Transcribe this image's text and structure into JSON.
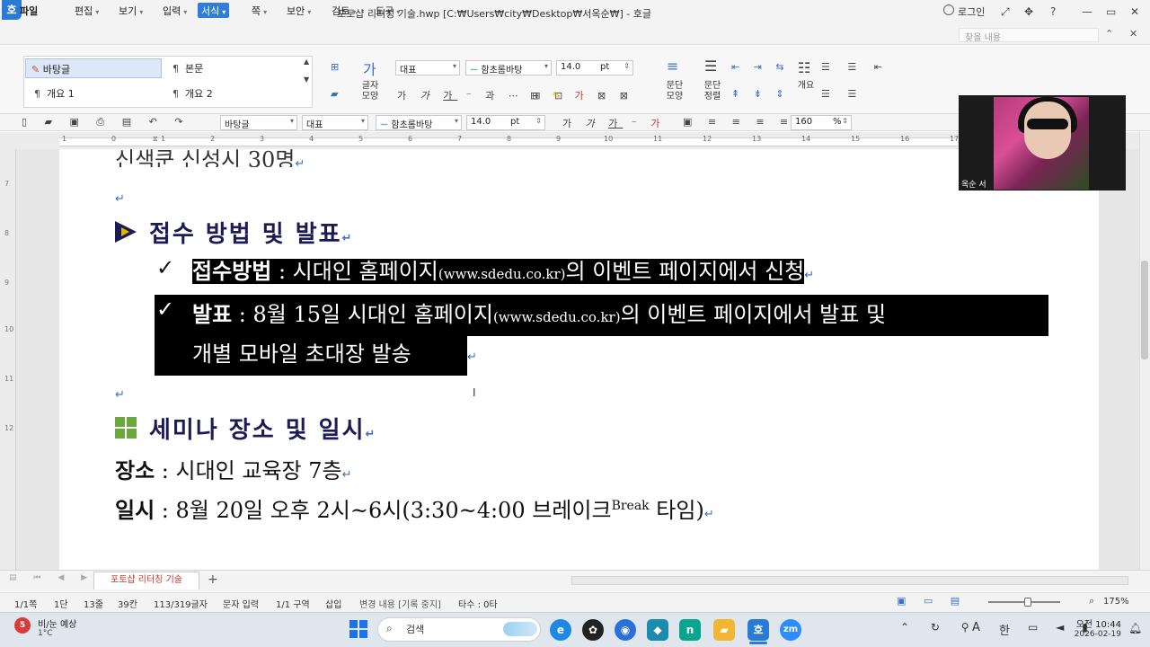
{
  "titlebar": {
    "logo": "호",
    "title": "포토샵 리터칭 기술.hwp [C:₩Users₩city₩Desktop₩서옥순₩] - 호글",
    "login": "로그인",
    "help": "?",
    "min": "—",
    "max": "▭",
    "close": "✕"
  },
  "menubar": {
    "file": "파일",
    "items": [
      "편집",
      "보기",
      "입력",
      "서식",
      "쪽",
      "보안",
      "검토",
      "도구"
    ],
    "find_placeholder": "찾을 내용"
  },
  "ribbon": {
    "styles": [
      "바탕글",
      "본문",
      "개요 1",
      "개요 2"
    ],
    "char_shape": "글자\n모양",
    "lang_combo": "대표",
    "font_combo": "함초롬바탕",
    "size_combo": "14.0",
    "size_unit": "pt",
    "para_shape": "문단\n모양",
    "para_sort": "문단\n정렬",
    "outline": "개요"
  },
  "toolbar2": {
    "style_combo": "바탕글",
    "lang_combo": "대표",
    "font_combo": "함초롬바탕",
    "size_combo": "14.0",
    "size_unit": "pt",
    "zoom_combo": "160",
    "zoom_unit": "%"
  },
  "ruler": {
    "h_ticks": [
      "1",
      "0",
      "1",
      "2",
      "3",
      "4",
      "5",
      "6",
      "7",
      "8",
      "9",
      "10",
      "11",
      "12",
      "13",
      "14",
      "15",
      "16",
      "17"
    ],
    "v_ticks": [
      "7",
      "8",
      "9",
      "10",
      "11",
      "12"
    ]
  },
  "document": {
    "cutoff_line": "신색쿤 신성시 30명",
    "heading1": "접수 방법 및 발표",
    "check1_label": "접수방법",
    "check1_a": " : 시대인 홈페이지",
    "check1_url": "(www.sdedu.co.kr)",
    "check1_b": "의 이벤트 페이지에서 신청",
    "check2_label": "발표",
    "check2_a": " : 8월 15일 시대인 홈페이지",
    "check2_url": "(www.sdedu.co.kr)",
    "check2_b": "의 이벤트 페이지에서 발표 및",
    "check2_c": "개별 모바일 초대장 발송",
    "heading2": "세미나 장소 및 일시",
    "place_label": "장소",
    "place_value": " : 시대인 교육장 7층",
    "time_label": "일시",
    "time_value": " : 8월 20일 오후 2시~6시(3:30~4:00 브레이크",
    "time_sup": "Break",
    "time_end": " 타임)",
    "para_mark": "↵",
    "check_mark": "✓"
  },
  "tabbar": {
    "doc_tab": "포토샵 리터칭 기술",
    "add": "+"
  },
  "statusbar": {
    "page": "1/1쪽",
    "section": "1단",
    "line": "13줄",
    "col": "39칸",
    "chars": "113/319글자",
    "input_mode": "문자 입력",
    "zone": "1/1 구역",
    "insert": "삽입",
    "track": "변경 내용 [기록 중지]",
    "typo": "타수 : 0타",
    "zoom": "175%"
  },
  "taskbar": {
    "weather_title": "비/눈 예상",
    "weather_temp": "1°C",
    "weather_badge": "5",
    "search": "검색",
    "ime_a": "A",
    "ime_han": "한",
    "time": "오전 10:44",
    "date": "2026-02-19"
  },
  "webcam": {
    "name": "옥순 서"
  }
}
